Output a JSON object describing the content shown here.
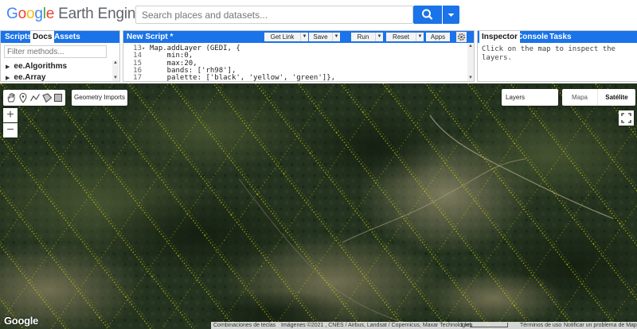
{
  "app": {
    "logo_letters": [
      "G",
      "o",
      "o",
      "g",
      "l",
      "e"
    ],
    "logo_rest": "Earth Engine"
  },
  "search": {
    "placeholder": "Search places and datasets..."
  },
  "left_panel": {
    "tabs": [
      "Scripts",
      "Docs",
      "Assets"
    ],
    "active_tab": "Docs",
    "filter_placeholder": "Filter methods...",
    "items": [
      "ee.Algorithms",
      "ee.Array"
    ]
  },
  "editor": {
    "title": "New Script *",
    "buttons": {
      "get_link": "Get Link",
      "save": "Save",
      "run": "Run",
      "reset": "Reset",
      "apps": "Apps"
    },
    "lines": [
      {
        "num": "13",
        "fold": "▾",
        "segments": [
          {
            "t": "Map.addLayer",
            "c": "c-fn"
          },
          {
            "t": " (GEDI, {",
            "c": ""
          }
        ]
      },
      {
        "num": "14",
        "fold": "",
        "segments": [
          {
            "t": "    min:",
            "c": ""
          },
          {
            "t": "0",
            "c": "c-num"
          },
          {
            "t": ",",
            "c": ""
          }
        ]
      },
      {
        "num": "15",
        "fold": "",
        "segments": [
          {
            "t": "    max:",
            "c": ""
          },
          {
            "t": "20",
            "c": "c-num"
          },
          {
            "t": ",",
            "c": ""
          }
        ]
      },
      {
        "num": "16",
        "fold": "",
        "segments": [
          {
            "t": "    bands: [",
            "c": ""
          },
          {
            "t": "'rh98'",
            "c": "c-str"
          },
          {
            "t": "],",
            "c": ""
          }
        ]
      },
      {
        "num": "17",
        "fold": "",
        "segments": [
          {
            "t": "    palette: [",
            "c": ""
          },
          {
            "t": "'black'",
            "c": "c-str"
          },
          {
            "t": ", ",
            "c": ""
          },
          {
            "t": "'yellow'",
            "c": "c-str"
          },
          {
            "t": ", ",
            "c": ""
          },
          {
            "t": "'green'",
            "c": "c-str"
          },
          {
            "t": "]},",
            "c": ""
          }
        ]
      }
    ]
  },
  "right_panel": {
    "tabs": [
      "Inspector",
      "Console",
      "Tasks"
    ],
    "active_tab": "Inspector",
    "inspector_text": "Click on the map to inspect the layers."
  },
  "map": {
    "geometry_imports": "Geometry Imports",
    "zoom_in": "+",
    "zoom_out": "−",
    "layers_label": "Layers",
    "map_type_map": "Mapa",
    "map_type_satellite": "Satélite",
    "google_mark": "Google",
    "attribution": {
      "shortcuts": "Combinaciones de teclas",
      "imagery": "Imágenes ©2021 , CNES / Airbus, Landsat / Copernicus, Maxar Technologies",
      "scale": "1 km",
      "terms": "Términos de uso",
      "report": "Notificar un problema de Maps"
    },
    "tools": [
      "hand-icon",
      "point-icon",
      "line-icon",
      "polygon-icon",
      "rectangle-icon"
    ]
  },
  "colors": {
    "accent": "#1a73e8",
    "gedi_track": "#e6e600",
    "terrain_dark": "#24331f"
  }
}
